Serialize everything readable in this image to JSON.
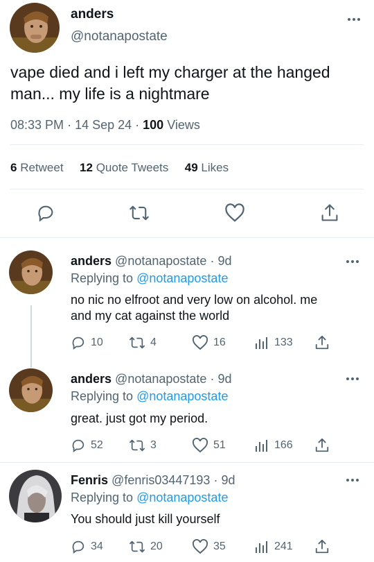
{
  "main_tweet": {
    "display_name": "anders",
    "handle": "@notanapostate",
    "text_line1": "vape died and i left my charger at the hanged",
    "text_line2": "man... my life is a nightmare",
    "time": "08:33 PM",
    "date": "14 Sep 24",
    "views_count": "100",
    "views_label": "Views",
    "retweets_count": "6",
    "retweets_label": "Retweet",
    "quotes_count": "12",
    "quotes_label": "Quote Tweets",
    "likes_count": "49",
    "likes_label": "Likes"
  },
  "replies": [
    {
      "display_name": "anders",
      "handle": "@notanapostate",
      "age": "9d",
      "replying_label": "Replying to",
      "replying_to": "@notanapostate",
      "text_line1": "no nic no elfroot and very low on alcohol. me",
      "text_line2": "and my cat against the world",
      "replies": "10",
      "retweets": "4",
      "likes": "16",
      "views": "133"
    },
    {
      "display_name": "anders",
      "handle": "@notanapostate",
      "age": "9d",
      "replying_label": "Replying to",
      "replying_to": "@notanapostate",
      "text_line1": "great. just got my period.",
      "replies": "52",
      "retweets": "3",
      "likes": "51",
      "views": "166"
    },
    {
      "display_name": "Fenris",
      "handle": "@fenris03447193",
      "age": "9d",
      "replying_label": "Replying to",
      "replying_to": "@notanapostate",
      "text_line1": "You should just kill yourself",
      "replies": "34",
      "retweets": "20",
      "likes": "35",
      "views": "241"
    }
  ],
  "colors": {
    "text": "#0f1419",
    "muted": "#536471",
    "link": "#1d9bf0",
    "divider": "#e6ecf0"
  }
}
